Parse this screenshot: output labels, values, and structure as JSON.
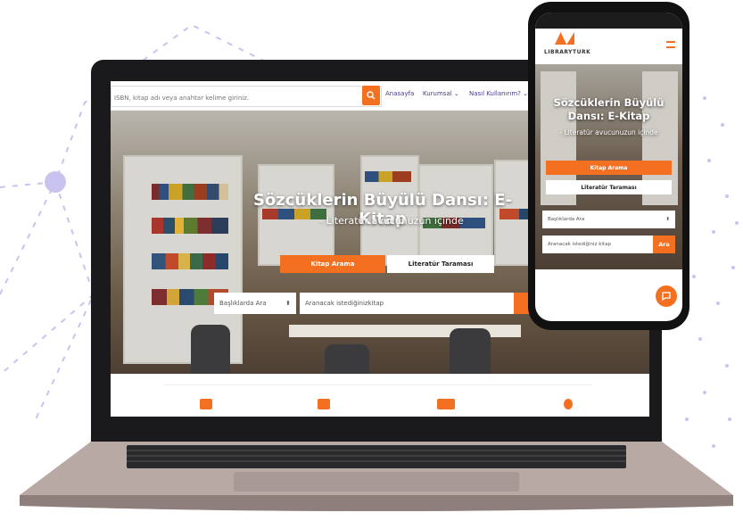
{
  "desktop": {
    "search_placeholder": "ISBN, kitap adı veya anahtar kelime giriniz.",
    "nav": [
      "Anasayfa",
      "Kurumsal",
      "Nasıl Kullanırım?"
    ],
    "hero_title": "Sözcüklerin Büyülü Dansı: E-Kitap",
    "hero_subtitle": "- Literatür avucunuzun içinde",
    "tab_search": "Kitap Arama",
    "tab_literature": "Literatür Taraması",
    "select_label": "Başlıklarda Ara",
    "query_placeholder": "Aranacak istediğinizkitap"
  },
  "mobile": {
    "brand_name": "LIBRARYTURK",
    "hero_title": "Sözcüklerin Büyülü Dansı: E-Kitap",
    "hero_subtitle": "- Literatür avucunuzun içinde",
    "btn_search": "Kitap Arama",
    "btn_literature": "Literatür Taraması",
    "select_label": "Başlıklarda Ara",
    "query_placeholder": "Aranacak istediğiniz kitap",
    "go_button": "Ara"
  },
  "colors": {
    "accent": "#f37021",
    "nav_text": "#4a3a8a",
    "dots": "#b7b0e6"
  },
  "icons": [
    "search-icon",
    "menu-icon",
    "chat-icon",
    "chevron-down-icon"
  ]
}
